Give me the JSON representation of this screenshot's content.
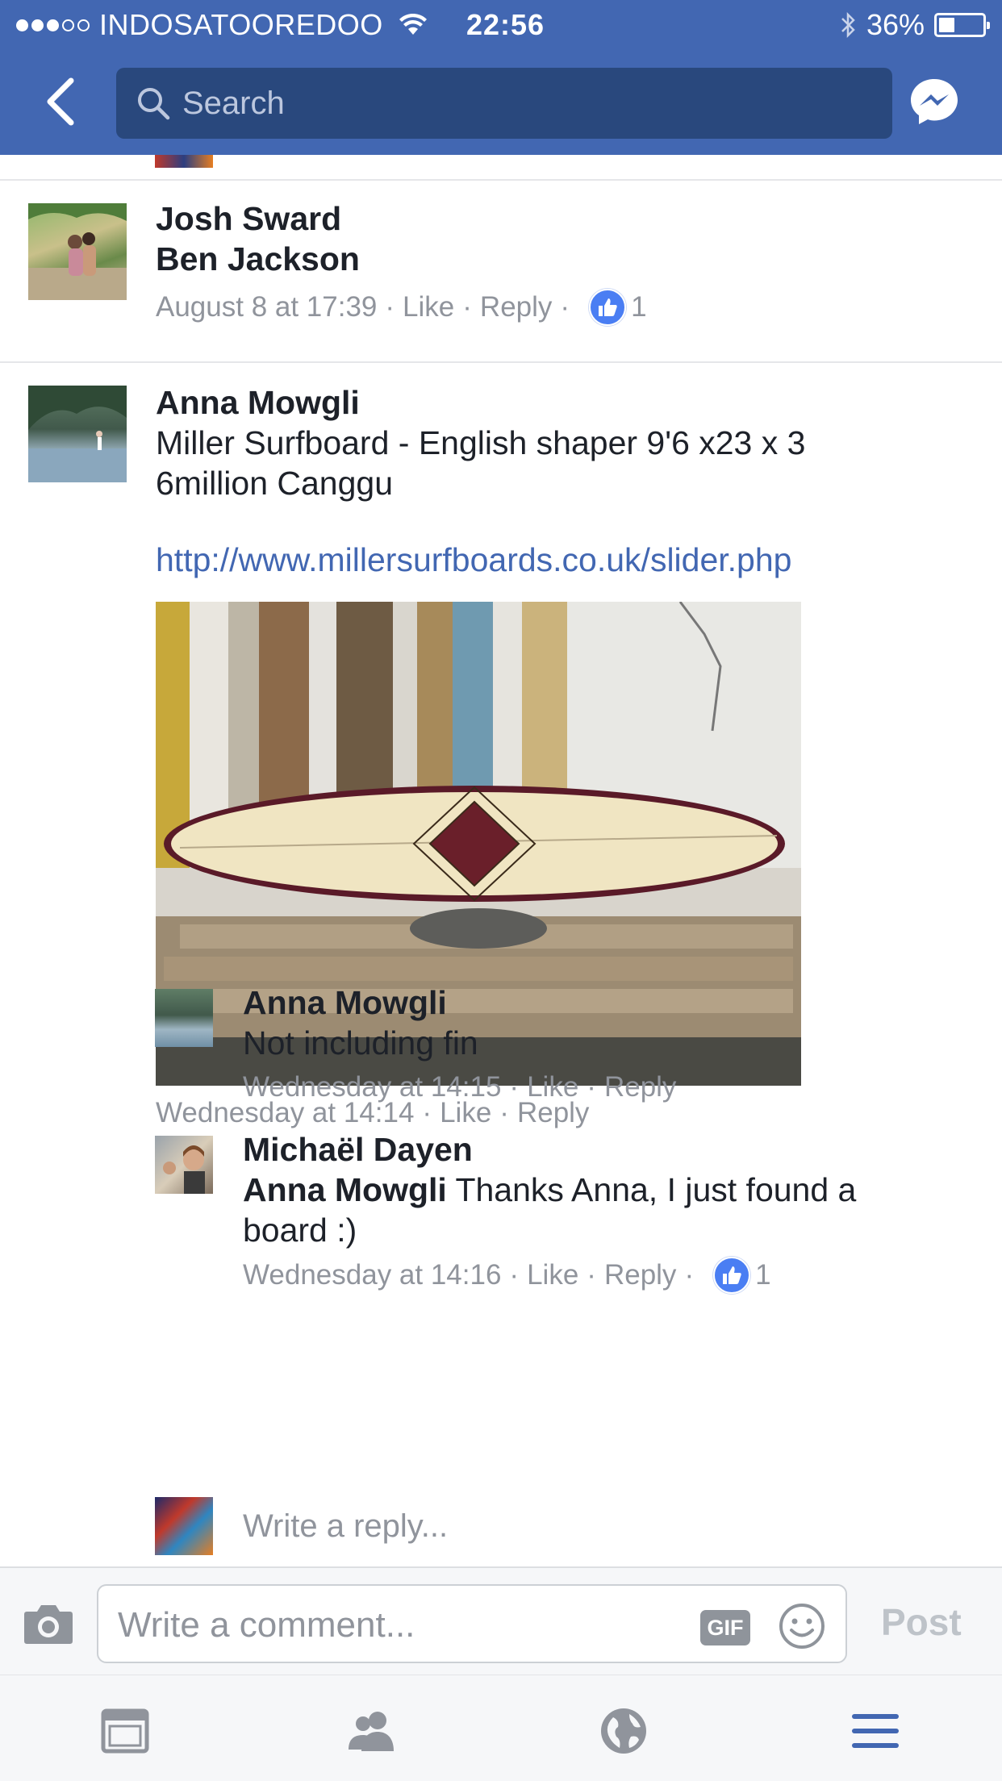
{
  "status_bar": {
    "carrier": "INDOSATOOREDOO",
    "time": "22:56",
    "battery": "36%",
    "battery_level": 0.36
  },
  "search": {
    "placeholder": "Search"
  },
  "comments": [
    {
      "author": "Josh Sward",
      "text": "Ben Jackson",
      "time": "August 8 at 17:39",
      "like": "Like",
      "reply": "Reply",
      "likes": "1"
    },
    {
      "author": "Anna Mowgli",
      "text_lines": [
        "Miller Surfboard - English shaper 9'6 x23 x 3",
        "6million Canggu"
      ],
      "link": "http://www.millersurfboards.co.uk/slider.php",
      "time": "Wednesday at 14:14",
      "like": "Like",
      "reply": "Reply",
      "replies": [
        {
          "author": "Anna Mowgli",
          "text": "Not including fin",
          "time": "Wednesday at 14:15",
          "like": "Like",
          "reply": "Reply"
        },
        {
          "author": "Michaël Dayen",
          "mention": "Anna Mowgli",
          "text_line1": " Thanks Anna, I just found a",
          "text_line2": "board :)",
          "time": "Wednesday at 14:16",
          "like": "Like",
          "reply": "Reply",
          "likes": "1"
        }
      ]
    }
  ],
  "write_reply": {
    "placeholder": "Write a reply..."
  },
  "composer": {
    "placeholder": "Write a comment...",
    "gif_label": "GIF",
    "post_label": "Post"
  },
  "colors": {
    "brand": "#4267b2",
    "search_bg": "#29487d",
    "meta": "#90949c",
    "like_badge": "#4a7ef3",
    "tab_active": "#4267b2",
    "tab_inactive": "#90949c"
  }
}
